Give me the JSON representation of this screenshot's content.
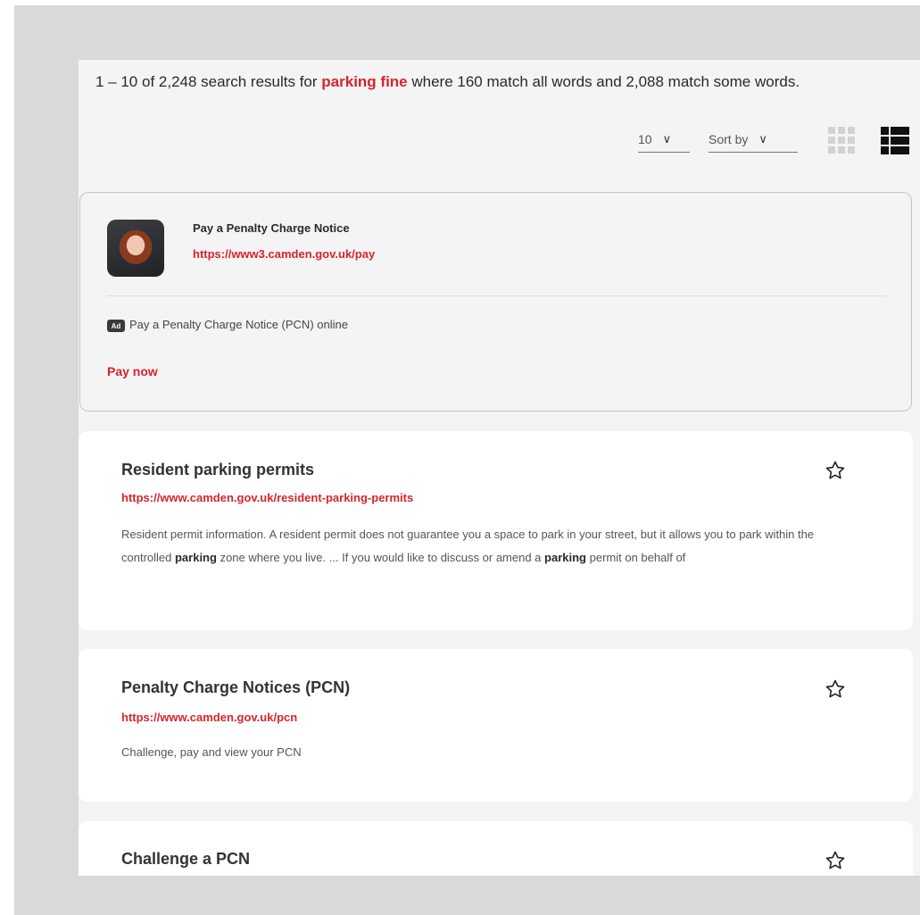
{
  "results_summary": {
    "prefix": "1 – 10 of 2,248 search results for",
    "query": "parking fine",
    "suffix": "where 160 match all words and 2,088 match some words."
  },
  "controls": {
    "per_page": "10",
    "sort_label": "Sort by",
    "view_grid_icon": "grid-view-icon",
    "view_list_icon": "list-view-icon"
  },
  "ad": {
    "title": "Pay a Penalty Charge Notice",
    "url": "https://www3.camden.gov.uk/pay",
    "badge": "Ad",
    "description": "Pay a Penalty Charge Notice (PCN) online",
    "cta": "Pay now"
  },
  "results": [
    {
      "title": "Resident parking permits",
      "url": "https://www.camden.gov.uk/resident-parking-permits",
      "snippet": [
        {
          "text": "Resident permit information. A resident permit does not guarantee you a space to park in your street, but it allows you to park within the controlled ",
          "bold": false
        },
        {
          "text": "parking",
          "bold": true
        },
        {
          "text": " zone where you live. ... If you would like to discuss or amend a ",
          "bold": false
        },
        {
          "text": "parking",
          "bold": true
        },
        {
          "text": " permit on behalf of",
          "bold": false
        }
      ]
    },
    {
      "title": "Penalty Charge Notices (PCN)",
      "url": "https://www.camden.gov.uk/pcn",
      "snippet": [
        {
          "text": "Challenge, pay and view your PCN",
          "bold": false
        }
      ]
    },
    {
      "title": "Challenge a PCN"
    }
  ],
  "colors": {
    "accent": "#d4252c",
    "frame": "#d9d9d9",
    "panel": "#f4f4f4"
  }
}
